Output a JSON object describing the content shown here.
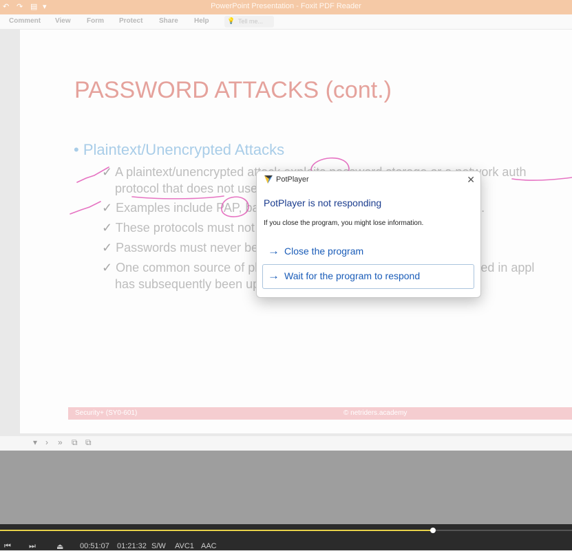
{
  "window": {
    "title": "PowerPoint Presentation - Foxit PDF Reader"
  },
  "menu": [
    "Comment",
    "View",
    "Form",
    "Protect",
    "Share",
    "Help"
  ],
  "tell_me": {
    "placeholder": "Tell me..."
  },
  "slide": {
    "title": "PASSWORD ATTACKS (cont.)",
    "main_bullet": "• Plaintext/Unencrypted Attacks",
    "subs": [
      "A plaintext/unencrypted attack exploits password storage or a network auth",
      "protocol that does not use encryption.",
      "Examples include PAP, basic HTTP/FTP authentication, and Telnet.",
      "These protocols must not be used.",
      "Passwords must never be sent over the network in plaintext.",
      "One common source of plaintext passwords is credentials embedded in appl",
      "has subsequently been uploaded to a public repository."
    ],
    "check": "✓",
    "footer_left": "Security+ (SY0-601)",
    "footer_center": "© netriders.academy"
  },
  "dialog": {
    "app_name": "PotPlayer",
    "heading": "PotPlayer is not responding",
    "message": "If you close the program, you might lose information.",
    "options": [
      {
        "label": "Close the program"
      },
      {
        "label": "Wait for the program to respond"
      }
    ],
    "arrow": "→",
    "close": "✕"
  },
  "player": {
    "time": "00:51:07",
    "duration": "01:21:32",
    "badges": [
      "S/W",
      "AVC1",
      "AAC"
    ],
    "progress": 0.757
  },
  "colors": {
    "accent": "#1a5cb8",
    "titlebar": "#f5c9a6",
    "slide_title": "#e5a29c",
    "ink": "#e25bb8"
  }
}
